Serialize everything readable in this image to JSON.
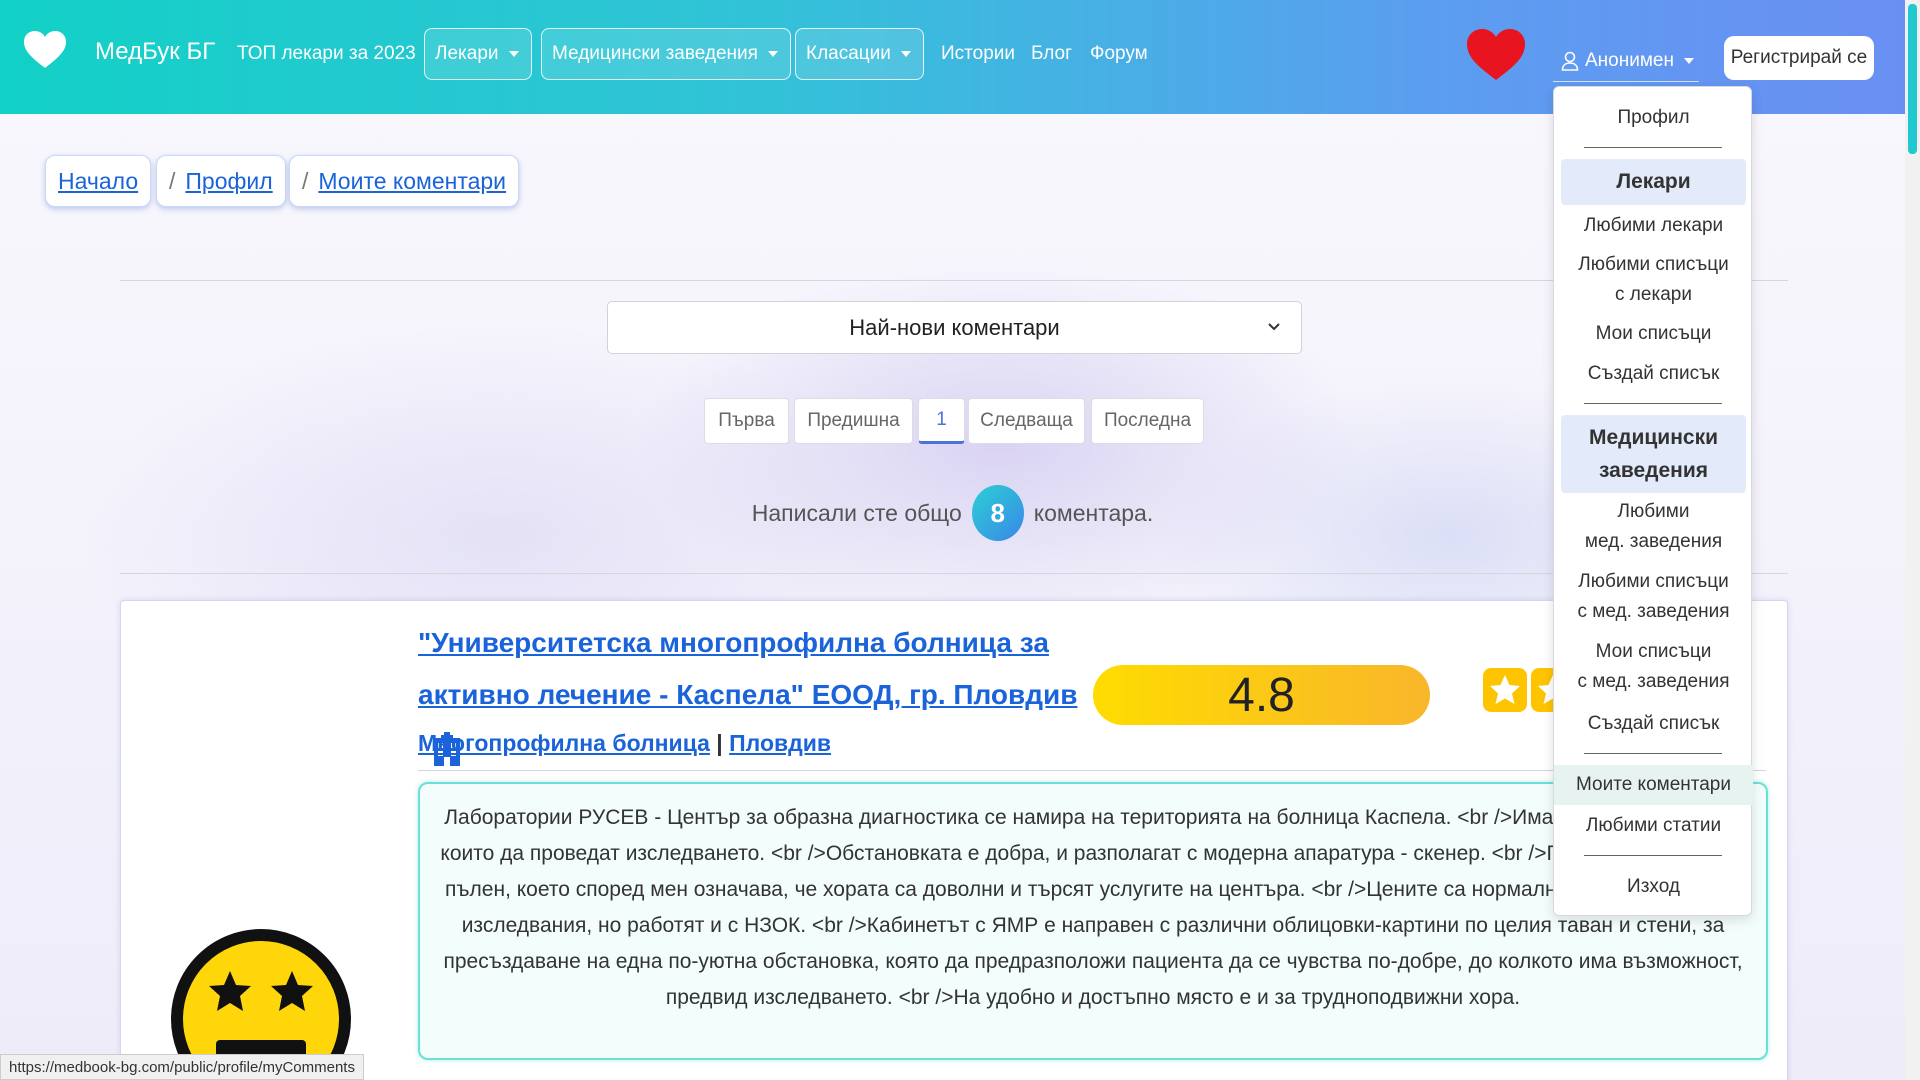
{
  "navbar": {
    "brand": "МедБук БГ",
    "top_doctors": "ТОП лекари за 2023",
    "doctors": "Лекари",
    "institutions": "Медицински заведения",
    "rankings": "Класации",
    "stories": "Истории",
    "blog": "Блог",
    "forum": "Форум",
    "user": "Анонимен",
    "register": "Регистрирай се",
    "accent_colors": [
      "#12d1c6",
      "#6a8ff3"
    ],
    "heart_color": "#e8141f"
  },
  "breadcrumb": {
    "home": "Начало",
    "profile": "Профил",
    "my_comments": "Моите коментари",
    "separator": "/"
  },
  "sort": {
    "selected": "Най-нови коментари"
  },
  "pagination": {
    "first": "Първа",
    "prev": "Предишна",
    "current": "1",
    "next": "Следваща",
    "last": "Последна"
  },
  "summary": {
    "before": "Написали сте общо",
    "count": "8",
    "after": "коментара."
  },
  "comment": {
    "title": "\"Университетска многопрофилна болница за активно лечение - Каспела\" ЕООД, гр. Пловдив",
    "category": "Многопрофилна болница",
    "divider": "|",
    "city": "Пловдив",
    "rating": "4.8",
    "stars_count": 5,
    "text": "Лаборатории РУСЕВ - Център за образна диагностика се намира на територията на болница Каспела. <br />Има професионалисти, които да проведат изследването. <br />Обстановката е добра, и разполагат с модерна апаратура - скенер. <br />Графикът е редовно пълен, което според мен означава, че хората са доволни и търсят услугите на центъра. <br />Цените са нормални като за този клас изследвания, но работят и с НЗОК. <br />Кабинетът с ЯМР е направен с различни облицовки-картини по целия таван и стени, за пресъздаване на една по-уютна обстановка, която да предразположи пациента да се чувства по-добре, до колкото има възможност, предвид изследването. <br />На удобно и достъпно място е и за трудноподвижни хора."
  },
  "user_menu": {
    "profile": "Профил",
    "doctors_head": "Лекари",
    "fav_doctors": "Любими лекари",
    "fav_doctor_lists_1": "Любими списъци",
    "fav_doctor_lists_2": "с лекари",
    "my_lists": "Мои списъци",
    "create_list": "Създай списък",
    "inst_head_1": "Медицински",
    "inst_head_2": "заведения",
    "fav_inst_1": "Любими",
    "fav_inst_2": "мед. заведения",
    "fav_inst_lists_1": "Любими списъци",
    "fav_inst_lists_2": "с мед. заведения",
    "my_inst_lists_1": "Мои списъци",
    "my_inst_lists_2": "с мед. заведения",
    "create_inst_list": "Създай списък",
    "my_comments": "Моите коментари",
    "fav_articles": "Любими статии",
    "logout": "Изход"
  },
  "status_bar": {
    "url": "https://medbook-bg.com/public/profile/myComments"
  }
}
